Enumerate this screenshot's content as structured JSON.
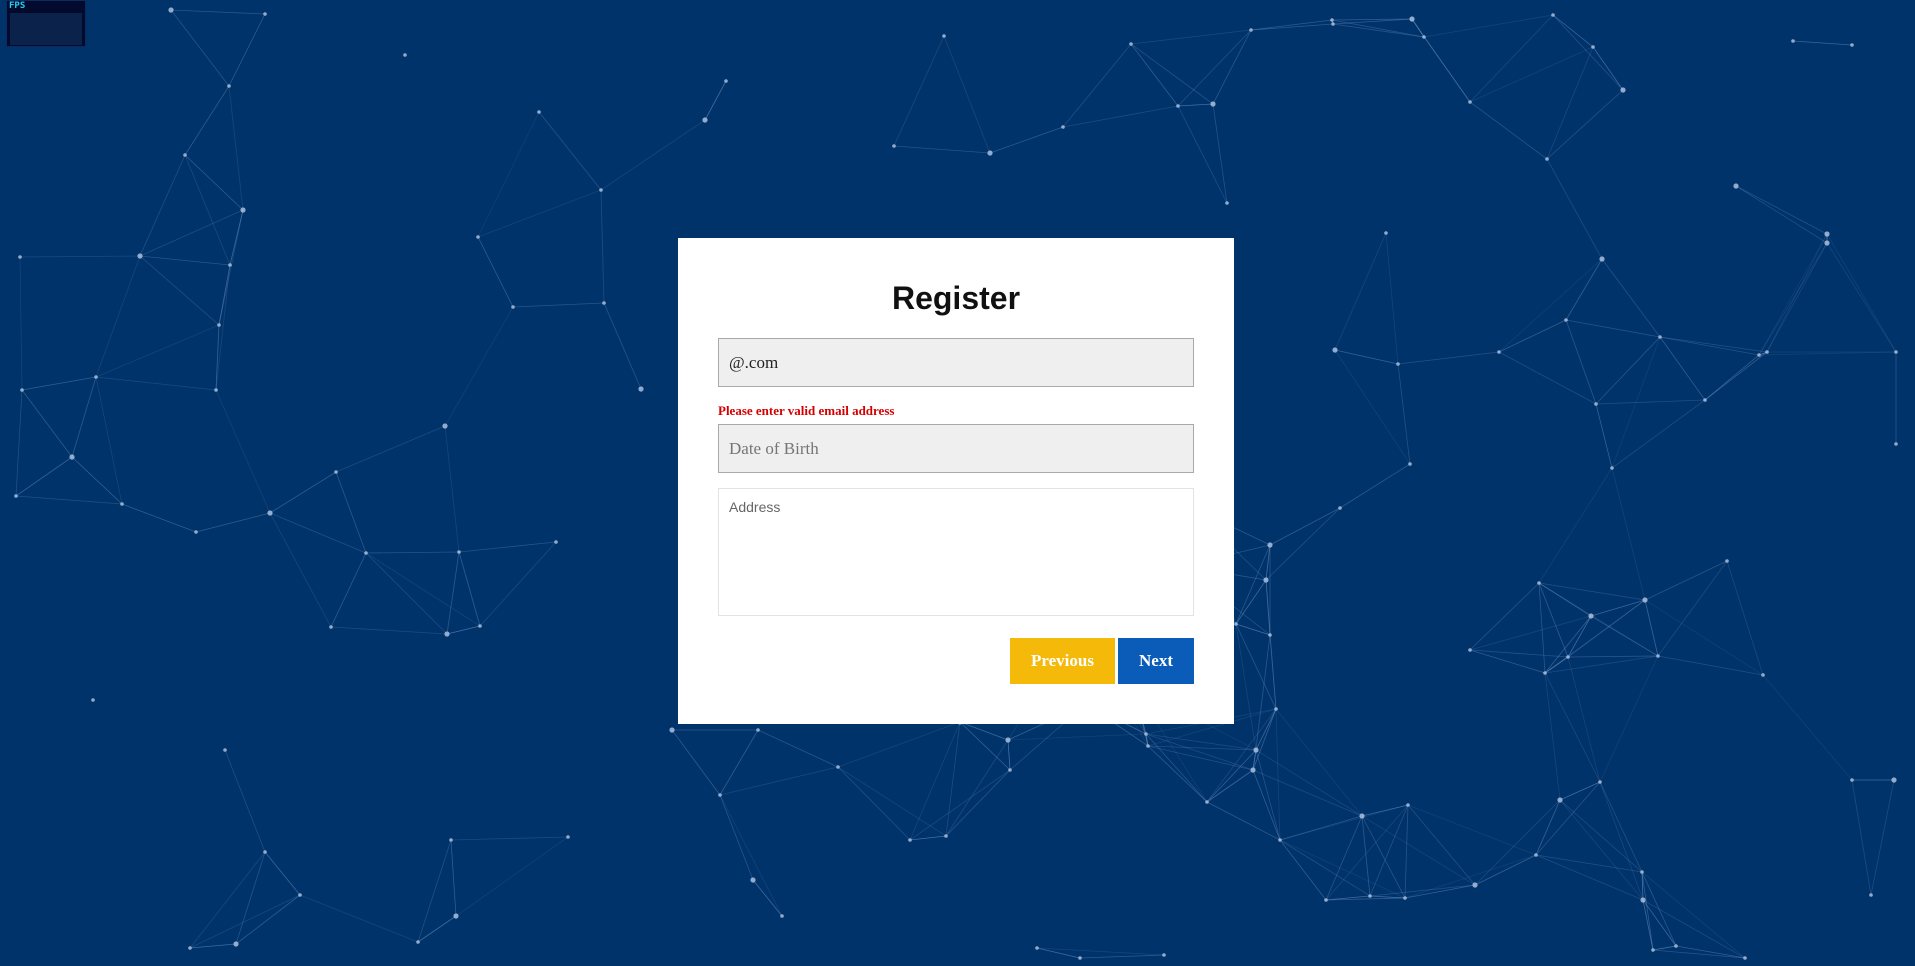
{
  "fps_meter": {
    "label": "FPS"
  },
  "form": {
    "title": "Register",
    "email_value": "@.com",
    "email_error": "Please enter valid email address",
    "dob_placeholder": "Date of Birth",
    "address_placeholder": "Address",
    "previous_label": "Previous",
    "next_label": "Next"
  },
  "colors": {
    "background": "#01336b",
    "network_lines": "#7fa3cf",
    "previous_button": "#f5b90a",
    "next_button": "#0b5cb9",
    "error_text": "#d40000"
  }
}
